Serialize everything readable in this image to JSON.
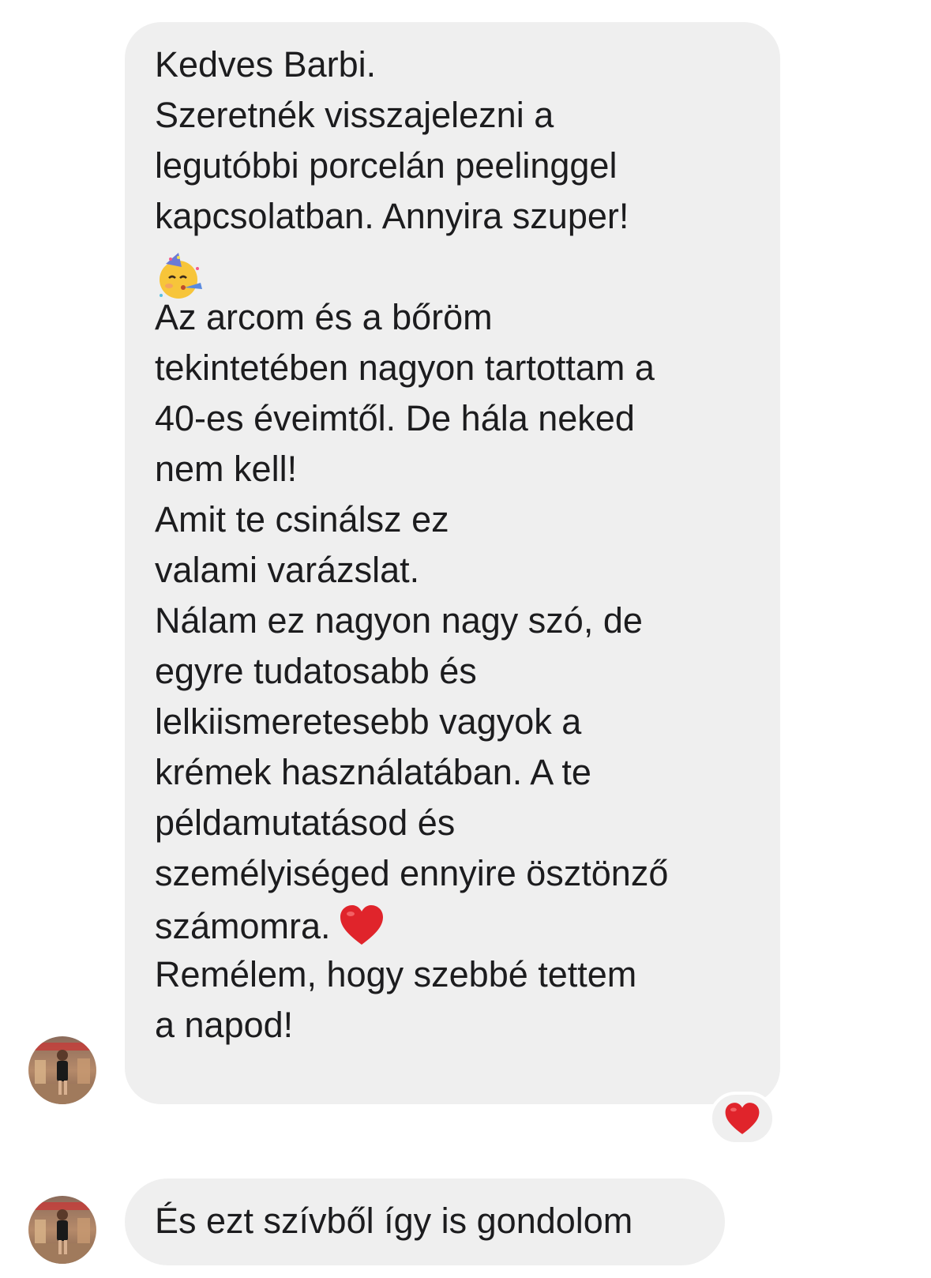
{
  "conversation": {
    "message1": {
      "lines_part1": [
        "Kedves Barbi.",
        "Szeretnék visszajelezni a",
        "legutóbbi porcelán peelinggel",
        "kapcsolatban. Annyira szuper!"
      ],
      "emoji_after_part1": "partying-face-icon",
      "lines_part2": [
        "Az arcom és a bőröm",
        "tekintetében nagyon tartottam a",
        "40-es éveimtől. De hála neked",
        "nem kell!",
        "Amit te csinálsz ez",
        "valami varázslat.",
        "Nálam ez nagyon nagy szó, de",
        "egyre tudatosabb és",
        "lelkiismeretesebb vagyok a",
        "krémek használatában. A te",
        "példamutatásod és",
        "személyiséged ennyire ösztönző",
        "számomra."
      ],
      "inline_emoji": "red-heart-icon",
      "lines_part3": [
        "Remélem, hogy szebbé tettem",
        "a napod!"
      ],
      "reaction": "red-heart-icon"
    },
    "message2": {
      "text": "És ezt szívből így is gondolom"
    }
  },
  "colors": {
    "bubble_bg": "#efefef",
    "text": "#1c1c1e",
    "heart": "#e0242b"
  }
}
